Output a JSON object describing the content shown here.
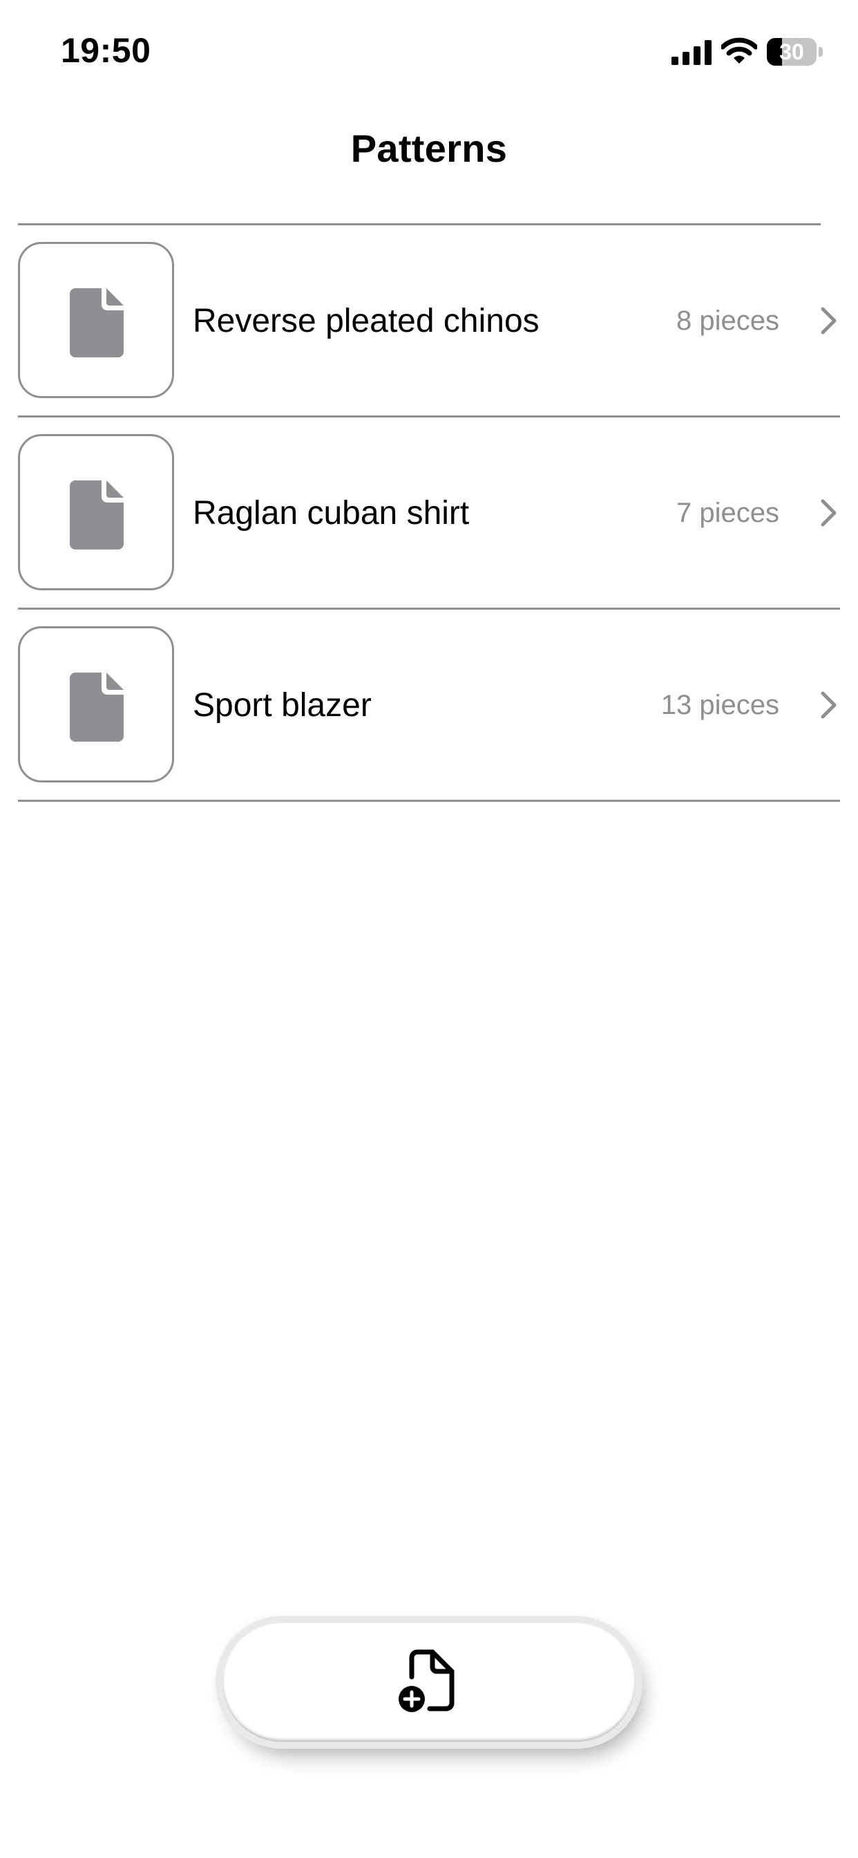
{
  "status_bar": {
    "time": "19:50",
    "battery_level": "30",
    "battery_fraction": 0.3,
    "icons": [
      "signal-icon",
      "wifi-icon",
      "battery-icon"
    ]
  },
  "navigation": {
    "title": "Patterns"
  },
  "patterns": [
    {
      "name": "Reverse pleated chinos",
      "pieces": "8 pieces",
      "icon": "document-icon"
    },
    {
      "name": "Raglan cuban shirt",
      "pieces": "7 pieces",
      "icon": "document-icon"
    },
    {
      "name": "Sport blazer",
      "pieces": "13 pieces",
      "icon": "document-icon"
    }
  ],
  "add_button": {
    "icon": "document-plus-icon"
  },
  "colors": {
    "accent": "#000000",
    "secondary_text": "#8e8e93",
    "divider": "#8e8e93",
    "icon_fill": "#8e8e93",
    "background": "#ffffff"
  }
}
